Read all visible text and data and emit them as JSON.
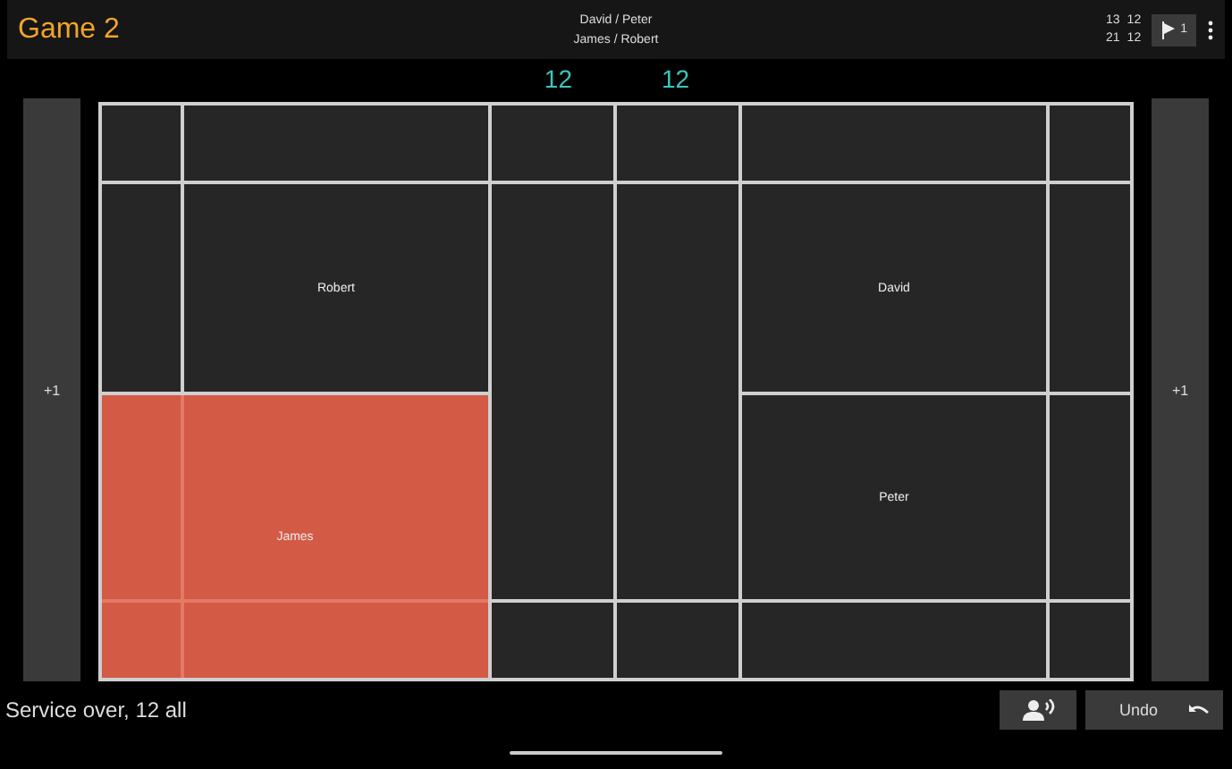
{
  "header": {
    "title": "Game 2",
    "teams": [
      "David / Peter",
      "James / Robert"
    ],
    "game_scores": [
      [
        "13",
        "12"
      ],
      [
        "21",
        "12"
      ]
    ],
    "flag_button": {
      "label": "1"
    }
  },
  "scores": [
    "12",
    "12"
  ],
  "side_buttons": [
    {
      "label": "+1"
    },
    {
      "label": "+1"
    }
  ],
  "court": {
    "left_back": {
      "name": "Robert",
      "selected": false
    },
    "left_front": {
      "name": "James",
      "selected": true
    },
    "right_back": {
      "name": "David",
      "selected": false
    },
    "right_front": {
      "name": "Peter",
      "selected": false
    }
  },
  "status": "Service over, 12 all",
  "undo_button": {
    "label": "Undo"
  }
}
